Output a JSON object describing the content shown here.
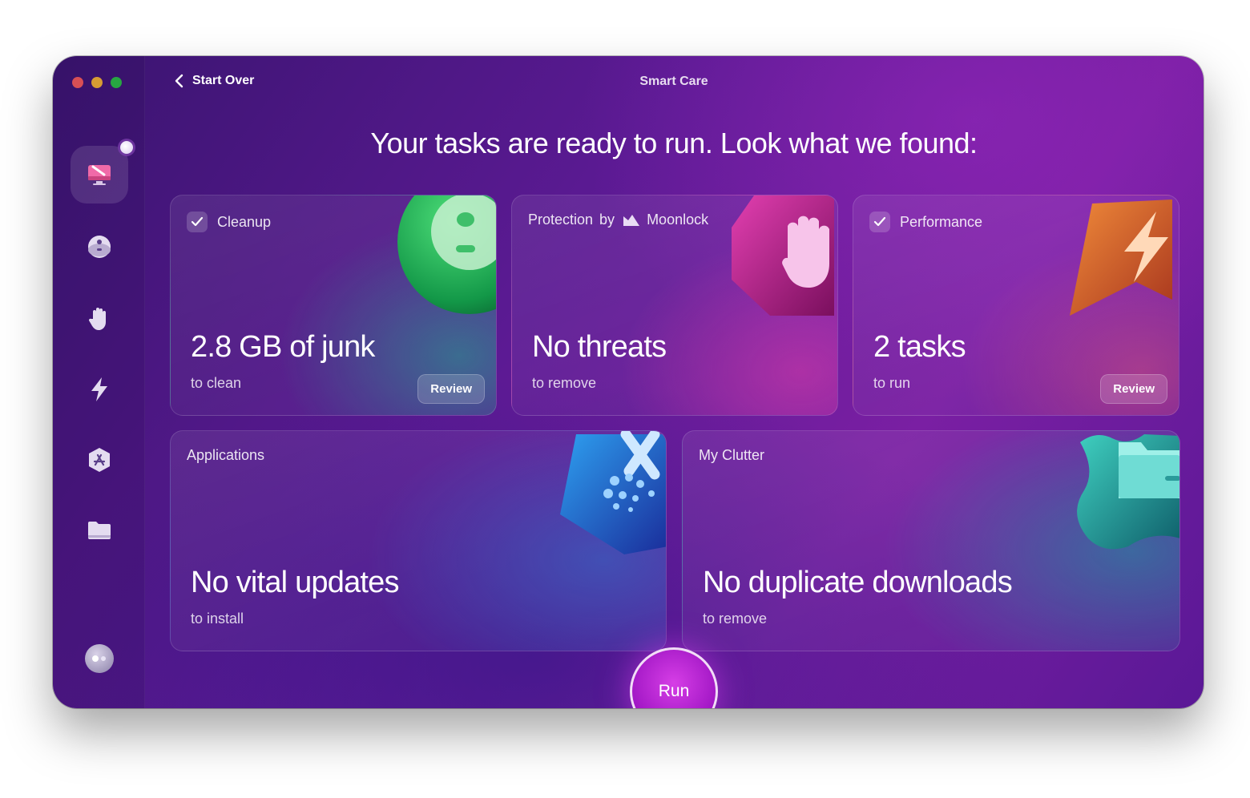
{
  "window": {
    "title": "Smart Care",
    "back_label": "Start Over"
  },
  "sidebar": {
    "items": [
      {
        "name": "smart-care",
        "icon": "monitor-sweep-icon",
        "active": true
      },
      {
        "name": "cleanup",
        "icon": "disk-sphere-icon"
      },
      {
        "name": "protection",
        "icon": "hand-icon"
      },
      {
        "name": "performance",
        "icon": "lightning-icon"
      },
      {
        "name": "applications",
        "icon": "app-store-icon"
      },
      {
        "name": "my-clutter",
        "icon": "folder-icon"
      }
    ],
    "assistant_icon": "assistant-eyes-icon"
  },
  "headline": "Your tasks are ready to run. Look what we found:",
  "cards": {
    "cleanup": {
      "label": "Cleanup",
      "checked": true,
      "value": "2.8 GB of junk",
      "sub": "to clean",
      "action": "Review"
    },
    "protection": {
      "label": "Protection",
      "by": "by",
      "brand": "Moonlock",
      "value": "No threats",
      "sub": "to remove"
    },
    "performance": {
      "label": "Performance",
      "checked": true,
      "value": "2 tasks",
      "sub": "to run",
      "action": "Review"
    },
    "applications": {
      "label": "Applications",
      "value": "No vital updates",
      "sub": "to install"
    },
    "clutter": {
      "label": "My Clutter",
      "value": "No duplicate downloads",
      "sub": "to remove"
    }
  },
  "run_label": "Run"
}
